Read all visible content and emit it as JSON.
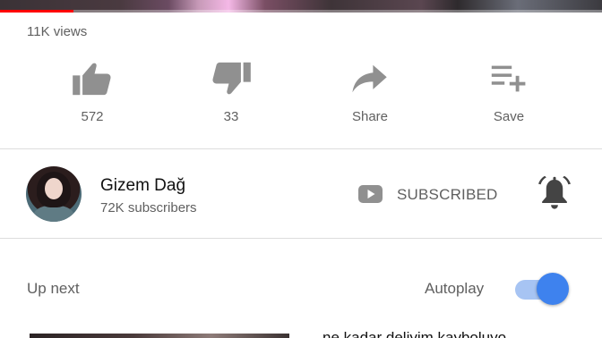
{
  "video": {
    "views": "11K views",
    "progress_fraction": 0.122
  },
  "actions": {
    "like": {
      "icon": "thumbs-up-icon",
      "label": "572"
    },
    "dislike": {
      "icon": "thumbs-down-icon",
      "label": "33"
    },
    "share": {
      "icon": "share-icon",
      "label": "Share"
    },
    "save": {
      "icon": "playlist-add-icon",
      "label": "Save"
    }
  },
  "channel": {
    "name": "Gizem Dağ",
    "subscribers": "72K subscribers",
    "subscribe_label": "SUBSCRIBED",
    "bell_icon": "notification-bell-icon"
  },
  "up_next": {
    "label": "Up next",
    "autoplay_label": "Autoplay",
    "autoplay_on": true,
    "next_title_partial": "ne kadar deliyim kayboluyo"
  },
  "colors": {
    "progress_played": "#ff0000",
    "toggle_knob": "#3e82ee",
    "toggle_track": "#a7c4f3",
    "icon_gray": "#909090"
  }
}
